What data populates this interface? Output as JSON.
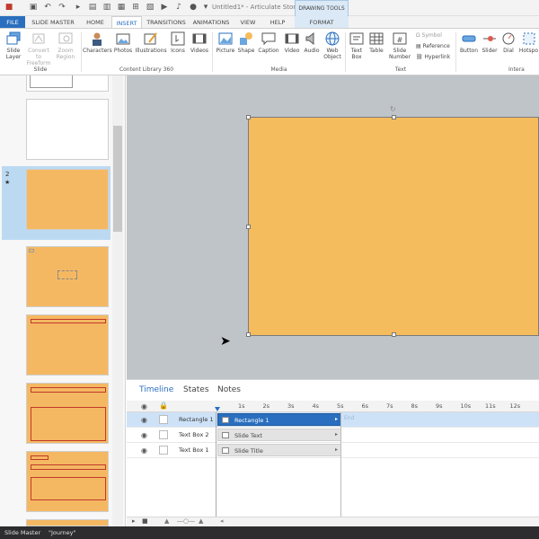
{
  "window": {
    "title": "Untitled1* - Articulate Story...",
    "contextual_tab": "DRAWING TOOLS"
  },
  "tabs": [
    {
      "label": "FILE"
    },
    {
      "label": "SLIDE MASTER"
    },
    {
      "label": "HOME"
    },
    {
      "label": "INSERT"
    },
    {
      "label": "TRANSITIONS"
    },
    {
      "label": "ANIMATIONS"
    },
    {
      "label": "VIEW"
    },
    {
      "label": "HELP"
    },
    {
      "label": "FORMAT"
    }
  ],
  "ribbon": {
    "slide": {
      "slide_layer": "Slide Layer",
      "convert": "Convert to Freeform",
      "zoom": "Zoom Region",
      "group": "Slide"
    },
    "content": {
      "characters": "Characters",
      "photos": "Photos",
      "illustrations": "Illustrations",
      "icons": "Icons",
      "videos": "Videos",
      "group": "Content Library 360"
    },
    "media": {
      "picture": "Picture",
      "shape": "Shape",
      "caption": "Caption",
      "video": "Video",
      "audio": "Audio",
      "web": "Web Object",
      "group": "Media"
    },
    "text": {
      "textbox": "Text Box",
      "table": "Table",
      "slidenum": "Slide Number",
      "symbol": "Symbol",
      "reference": "Reference",
      "hyperlink": "Hyperlink",
      "group": "Text"
    },
    "inter": {
      "button": "Button",
      "slider": "Slider",
      "dial": "Dial",
      "hotspot": "Hotspo",
      "group": "Intera"
    }
  },
  "slides_panel": {
    "selected_number": "2",
    "selected_star": "★"
  },
  "timeline": {
    "tabs": [
      "Timeline",
      "States",
      "Notes"
    ],
    "seconds": [
      "1s",
      "2s",
      "3s",
      "4s",
      "5s",
      "6s",
      "7s",
      "8s",
      "9s",
      "10s",
      "11s",
      "12s"
    ],
    "end_label": "End",
    "rows": [
      {
        "name": "Rectangle 1",
        "bar": "Rectangle 1",
        "selected": true
      },
      {
        "name": "Text Box 2",
        "bar": "Slide Text",
        "selected": false
      },
      {
        "name": "Text Box 1",
        "bar": "Slide Title",
        "selected": false
      }
    ]
  },
  "status_bar": {
    "view": "Slide Master",
    "theme": "\"Journey\""
  },
  "colors": {
    "accent": "#2a6fbf",
    "slide_fill": "#f5bc5e",
    "canvas": "#bfc4c9"
  }
}
